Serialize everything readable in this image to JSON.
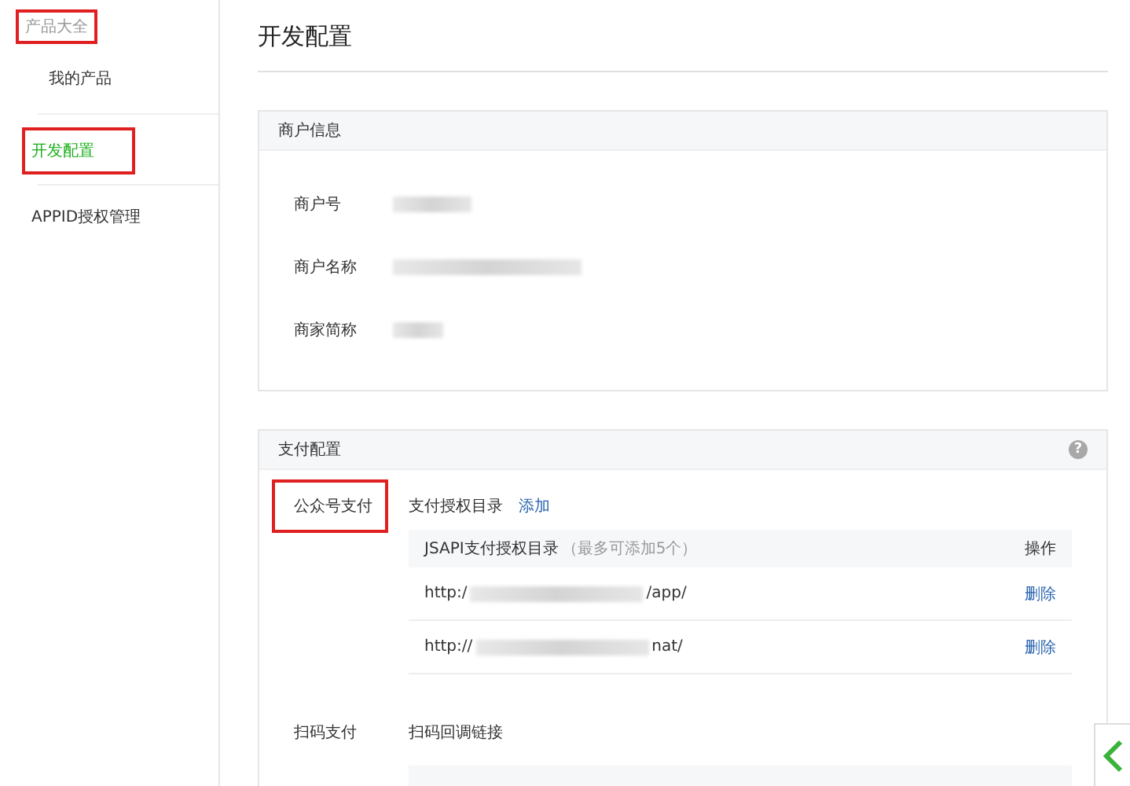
{
  "sidebar": {
    "items": [
      {
        "label": "产品大全",
        "kind": "heading",
        "selected": false,
        "highlighted": true
      },
      {
        "label": "我的产品",
        "kind": "sub",
        "selected": false,
        "highlighted": false
      },
      {
        "label": "开发配置",
        "kind": "item",
        "selected": true,
        "highlighted": true
      },
      {
        "label": "APPID授权管理",
        "kind": "item",
        "selected": false,
        "highlighted": false
      }
    ]
  },
  "page_title": "开发配置",
  "merchant_card": {
    "title": "商户信息",
    "fields": [
      {
        "label": "商户号",
        "redacted": true
      },
      {
        "label": "商户名称",
        "redacted": true
      },
      {
        "label": "商家简称",
        "redacted": true
      }
    ]
  },
  "payment_card": {
    "title": "支付配置",
    "help": "?",
    "sections": [
      {
        "label": "公众号支付",
        "highlighted": true,
        "heading": "支付授权目录",
        "action": "添加",
        "table": {
          "columns": [
            "JSAPI支付授权目录",
            "操作"
          ],
          "column_note": "（最多可添加5个）",
          "rows": [
            {
              "prefix": "http:/",
              "suffix": "/app/",
              "action": "删除"
            },
            {
              "prefix": "http://",
              "suffix": "nat/",
              "action": "删除"
            }
          ]
        }
      },
      {
        "label": "扫码支付",
        "highlighted": false,
        "heading": "扫码回调链接"
      }
    ]
  }
}
